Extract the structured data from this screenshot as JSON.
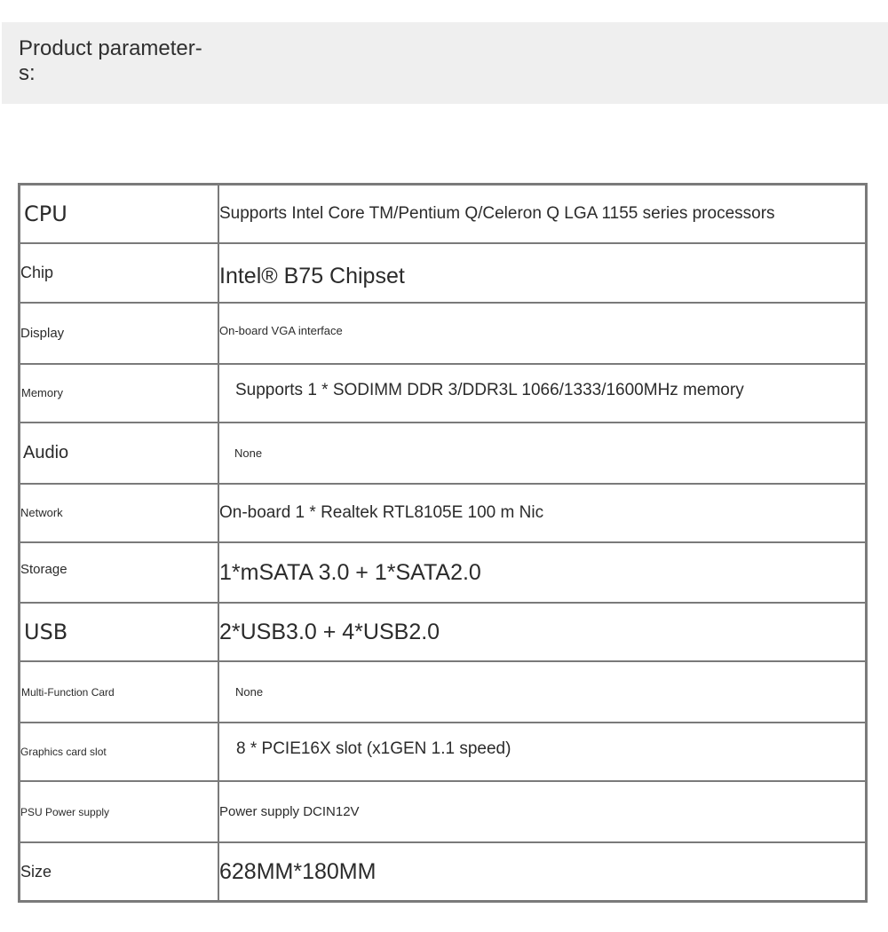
{
  "header": {
    "title": "Product parameter-\ns:"
  },
  "specs": {
    "rows": [
      {
        "label": "CPU",
        "value": "Supports Intel Core TM/Pentium Q/Celeron Q LGA 1155 series processors"
      },
      {
        "label": "Chip",
        "value": "Intel® B75 Chipset"
      },
      {
        "label": "Display",
        "value": "On-board VGA interface"
      },
      {
        "label": "Memory",
        "value": "Supports 1 * SODIMM DDR 3/DDR3L 1066/1333/1600MHz memory"
      },
      {
        "label": "Audio",
        "value": "None"
      },
      {
        "label": "Network",
        "value": "On-board 1 * Realtek RTL8105E 100 m Nic"
      },
      {
        "label": "Storage",
        "value": "1*mSATA 3.0 + 1*SATA2.0"
      },
      {
        "label": "USB",
        "value": "2*USB3.0 + 4*USB2.0"
      },
      {
        "label": "Multi-Function Card",
        "value": "None"
      },
      {
        "label": "Graphics card slot",
        "value": "8 * PCIE16X slot (x1GEN 1.1 speed)"
      },
      {
        "label": "PSU Power supply",
        "value": "Power supply DCIN12V"
      },
      {
        "label": "Size",
        "value": "628MM*180MM"
      }
    ]
  }
}
